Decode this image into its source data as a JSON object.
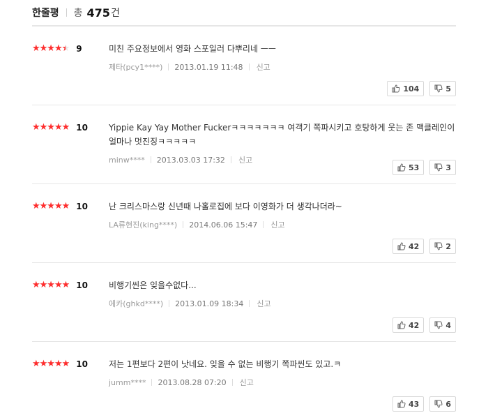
{
  "header": {
    "title": "한줄평",
    "total_label": "총",
    "total_count": "475",
    "total_unit": "건"
  },
  "reviews": [
    {
      "stars_pct": 90,
      "score": "9",
      "text": "미친 주요정보에서 영화 스포일러 다뿌리네 ㅡㅡ",
      "user": "제타(pcy1****)",
      "date": "2013.01.19 11:48",
      "report": "신고",
      "likes": "104",
      "dislikes": "5"
    },
    {
      "stars_pct": 100,
      "score": "10",
      "text": "Yippie Kay Yay Mother Fuckerㅋㅋㅋㅋㅋㅋㅋ 여객기 쪽파시키고 호탕하게 웃는 존 맥클레인이 얼마나 멋진징ㅋㅋㅋㅋㅋ",
      "user": "minw****",
      "date": "2013.03.03 17:32",
      "report": "신고",
      "likes": "53",
      "dislikes": "3"
    },
    {
      "stars_pct": 100,
      "score": "10",
      "text": "난 크리스마스랑 신년때 나홀로집에 보다 이영화가 더 생각나더라~",
      "user": "LA류현진(king****)",
      "date": "2014.06.06 15:47",
      "report": "신고",
      "likes": "42",
      "dislikes": "2"
    },
    {
      "stars_pct": 100,
      "score": "10",
      "text": "비행기씬은 잊을수없다...",
      "user": "에카(ghkd****)",
      "date": "2013.01.09 18:34",
      "report": "신고",
      "likes": "42",
      "dislikes": "4"
    },
    {
      "stars_pct": 100,
      "score": "10",
      "text": "저는 1편보다 2편이 낫네요. 잊을 수 없는 비행기 쪽파씬도 있고.ㅋ",
      "user": "jumm****",
      "date": "2013.08.28 07:20",
      "report": "신고",
      "likes": "43",
      "dislikes": "6"
    }
  ],
  "colors": {
    "star": "#ff2d2d",
    "star_empty": "#e6e6e6"
  },
  "icons": {
    "like": "thumbs-up-icon",
    "dislike": "thumbs-down-icon"
  }
}
